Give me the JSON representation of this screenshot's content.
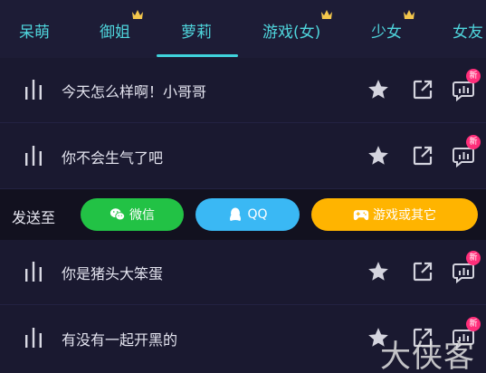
{
  "tabs": [
    {
      "label": "呆萌",
      "crown": false
    },
    {
      "label": "御姐",
      "crown": true
    },
    {
      "label": "萝莉",
      "crown": false,
      "active": true
    },
    {
      "label": "游戏(女)",
      "crown": true
    },
    {
      "label": "少女",
      "crown": true
    },
    {
      "label": "女友",
      "crown": false
    }
  ],
  "rows": [
    {
      "text": "今天怎么样啊！小哥哥",
      "badge": "新"
    },
    {
      "text": "你不会生气了吧",
      "badge": "新"
    },
    {
      "text": "你是猪头大笨蛋",
      "badge": "新"
    },
    {
      "text": "有没有一起开黑的",
      "badge": "新"
    }
  ],
  "send": {
    "label": "发送至",
    "wechat": "微信",
    "qq": "QQ",
    "game": "游戏或其它"
  },
  "colors": {
    "accent": "#3fd3dc",
    "badge": "#ff2e7a",
    "wechat": "#22c245",
    "qq": "#3ab8f4",
    "game": "#ffb400"
  },
  "watermark": "大侠客"
}
